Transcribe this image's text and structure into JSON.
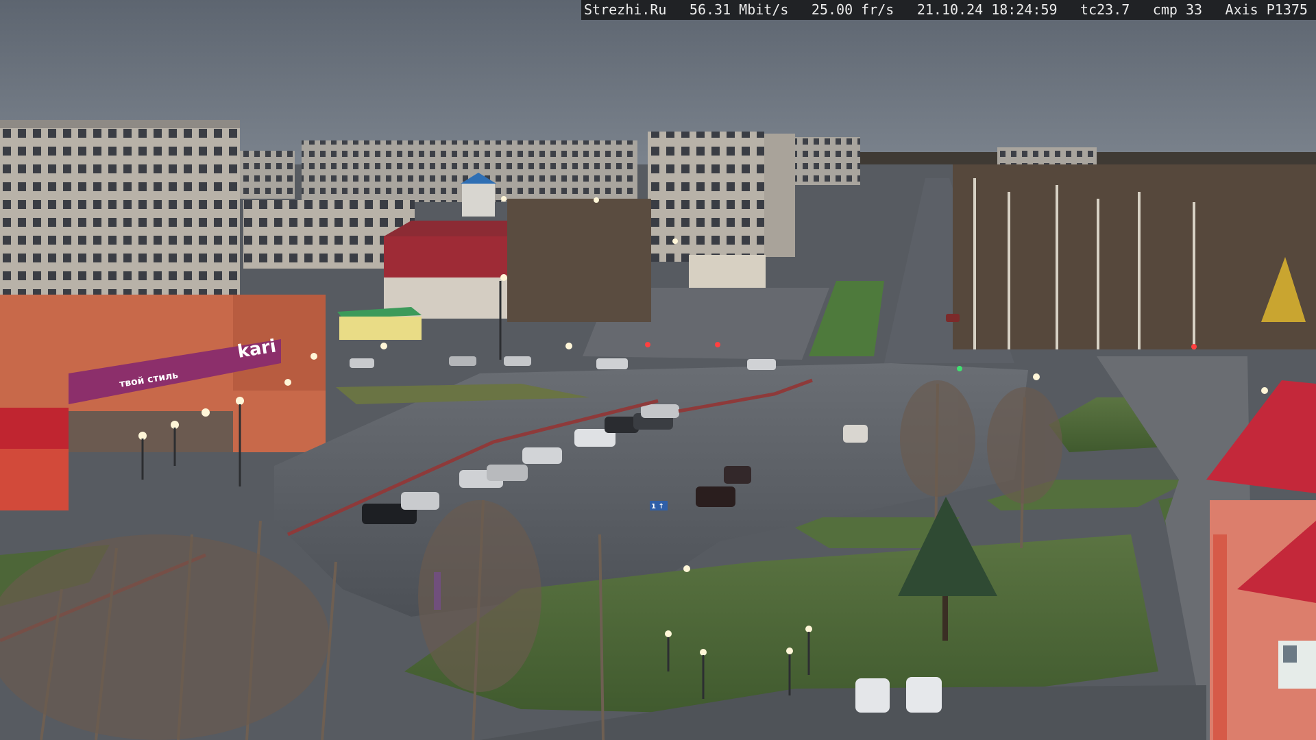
{
  "osd": {
    "site": "Strezhi.Ru",
    "bitrate": "56.31 Mbit/s",
    "fps": "25.00 fr/s",
    "datetime": "21.10.24 18:24:59",
    "tc": "tc23.7",
    "cmp": "cmp 33",
    "camera": "Axis P1375"
  },
  "signs": {
    "store_brand": "kari",
    "store_slogan": "твой стиль",
    "road_sign": "1 ↑"
  },
  "colors": {
    "sky": "#6e7681",
    "asphalt": "#55595f",
    "grass": "#4f6b3a",
    "store_magenta": "#8c2f6b",
    "roof_red": "#c4283a"
  }
}
